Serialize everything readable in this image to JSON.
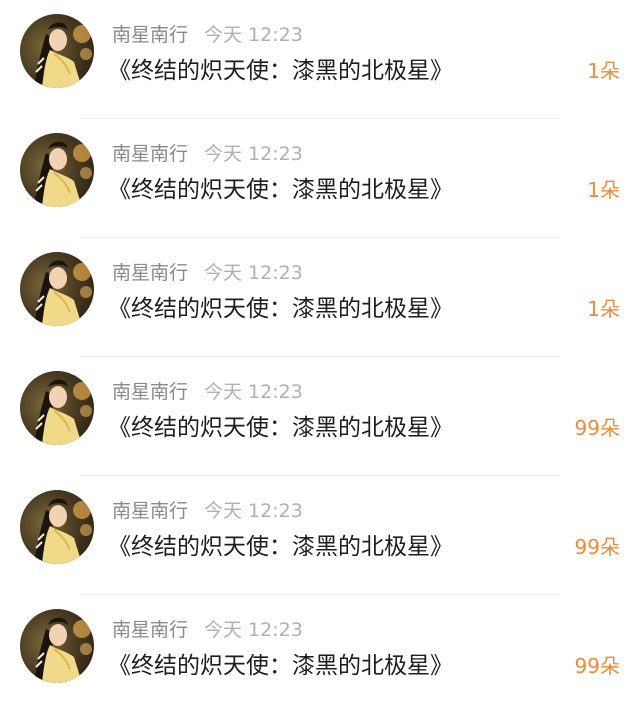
{
  "colors": {
    "accent": "#ef8a3a",
    "name": "#8a8a8a",
    "time": "#b0b0b0",
    "title": "#1e1e1e",
    "divider": "#efefef"
  },
  "avatar_icon": "portrait-avatar-icon",
  "items": [
    {
      "name": "南星南行",
      "time": "今天 12:23",
      "title": "《终结的炽天使：漆黑的北极星》",
      "count": "1朵"
    },
    {
      "name": "南星南行",
      "time": "今天 12:23",
      "title": "《终结的炽天使：漆黑的北极星》",
      "count": "1朵"
    },
    {
      "name": "南星南行",
      "time": "今天 12:23",
      "title": "《终结的炽天使：漆黑的北极星》",
      "count": "1朵"
    },
    {
      "name": "南星南行",
      "time": "今天 12:23",
      "title": "《终结的炽天使：漆黑的北极星》",
      "count": "99朵"
    },
    {
      "name": "南星南行",
      "time": "今天 12:23",
      "title": "《终结的炽天使：漆黑的北极星》",
      "count": "99朵"
    },
    {
      "name": "南星南行",
      "time": "今天 12:23",
      "title": "《终结的炽天使：漆黑的北极星》",
      "count": "99朵"
    }
  ]
}
